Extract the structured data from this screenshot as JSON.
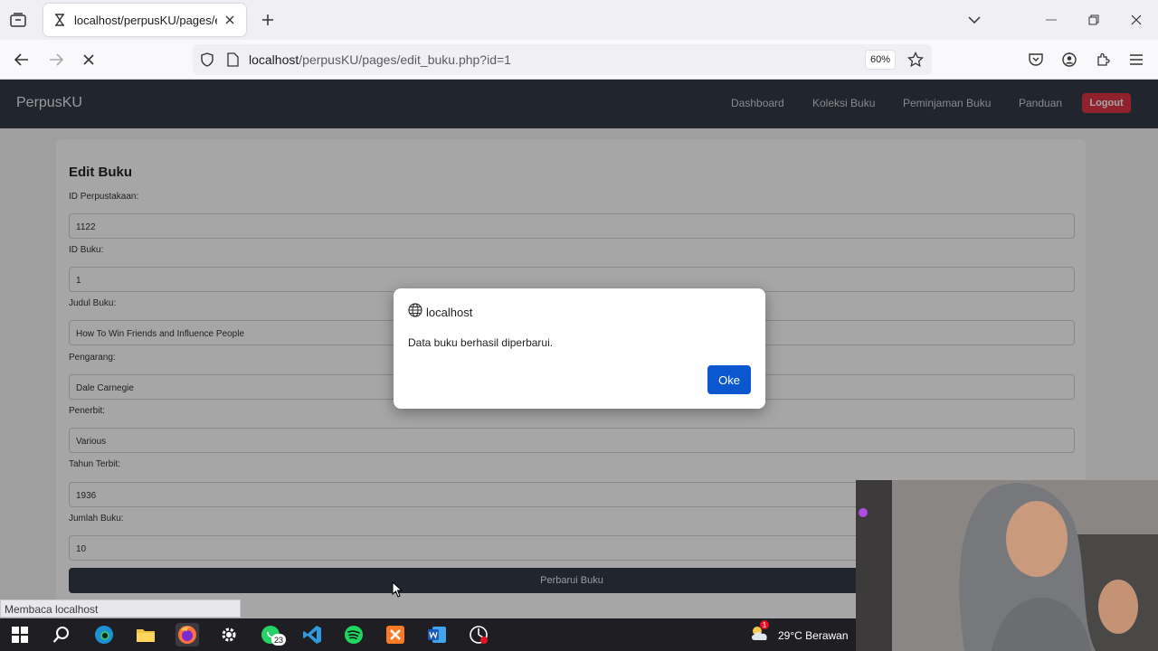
{
  "browser": {
    "tab_title": "localhost/perpusKU/pages/edit_buku",
    "url_host": "localhost",
    "url_path": "/perpusKU/pages/edit_buku.php?id=1",
    "zoom": "60%",
    "status_text": "Membaca localhost"
  },
  "app": {
    "brand": "PerpusKU",
    "nav": [
      "Dashboard",
      "Koleksi Buku",
      "Peminjaman Buku",
      "Panduan"
    ],
    "logout_label": "Logout"
  },
  "form": {
    "title": "Edit Buku",
    "fields": [
      {
        "label": "ID Perpustakaan:",
        "value": "1122"
      },
      {
        "label": "ID Buku:",
        "value": "1"
      },
      {
        "label": "Judul Buku:",
        "value": "How To Win Friends and Influence People"
      },
      {
        "label": "Pengarang:",
        "value": "Dale Carnegie"
      },
      {
        "label": "Penerbit:",
        "value": "Various"
      },
      {
        "label": "Tahun Terbit:",
        "value": "1936"
      },
      {
        "label": "Jumlah Buku:",
        "value": "10"
      }
    ],
    "submit_label": "Perbarui Buku"
  },
  "dialog": {
    "origin": "localhost",
    "message": "Data buku berhasil diperbarui.",
    "ok_label": "Oke"
  },
  "taskbar": {
    "whatsapp_badge": "23",
    "weather_badge": "1",
    "weather_text": "29°C  Berawan"
  },
  "colors": {
    "navbar": "#343a46",
    "logout": "#dc3545",
    "dialog_button": "#0b57d0"
  }
}
